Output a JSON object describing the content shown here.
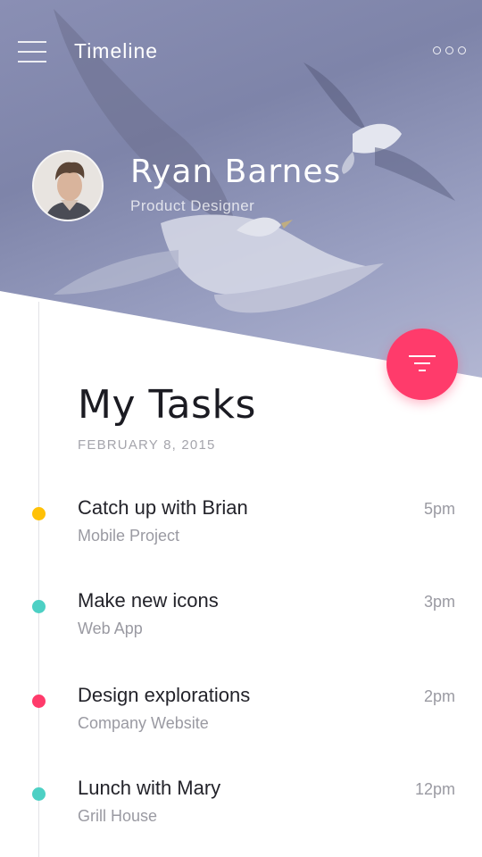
{
  "topbar": {
    "title": "Timeline",
    "menu_icon": "hamburger-icon",
    "more_icon": "more-options-icon"
  },
  "profile": {
    "name": "Ryan Barnes",
    "role": "Product Designer"
  },
  "fab": {
    "icon": "filter-icon",
    "color": "#ff3b6b"
  },
  "tasks_section": {
    "title": "My Tasks",
    "date": "FEBRUARY 8, 2015"
  },
  "tasks": [
    {
      "title": "Catch up with Brian",
      "subtitle": "Mobile Project",
      "time": "5pm",
      "color": "#ffc107"
    },
    {
      "title": "Make new icons",
      "subtitle": "Web App",
      "time": "3pm",
      "color": "#4dd0c4"
    },
    {
      "title": "Design explorations",
      "subtitle": "Company Website",
      "time": "2pm",
      "color": "#ff3b6b"
    },
    {
      "title": "Lunch with Mary",
      "subtitle": "Grill House",
      "time": "12pm",
      "color": "#4dd0c4"
    }
  ]
}
